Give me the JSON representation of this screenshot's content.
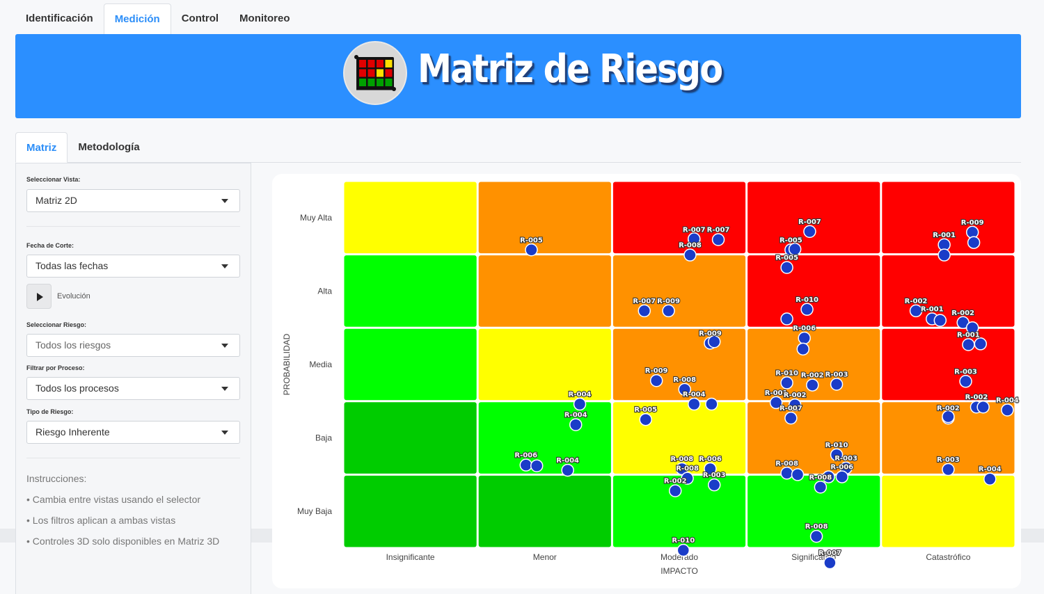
{
  "top_tabs": [
    {
      "label": "Identificación",
      "active": false
    },
    {
      "label": "Medición",
      "active": true
    },
    {
      "label": "Control",
      "active": false
    },
    {
      "label": "Monitoreo",
      "active": false
    }
  ],
  "banner": {
    "title": "Matriz de Riesgo",
    "background": "#2b8fff",
    "logo_cell_colors": [
      "#e00000",
      "#e00000",
      "#e00000",
      "#ffe000",
      "#e00000",
      "#e00000",
      "#ffe000",
      "#e00000",
      "#00a000",
      "#00a000",
      "#00a000",
      "#00a000"
    ]
  },
  "sub_tabs": [
    {
      "label": "Matriz",
      "active": true
    },
    {
      "label": "Metodología",
      "active": false
    }
  ],
  "sidebar": {
    "vista_label": "Seleccionar Vista:",
    "vista_value": "Matriz 2D",
    "fecha_label": "Fecha de Corte:",
    "fecha_value": "Todas las fechas",
    "evolucion_label": "Evolución",
    "riesgo_label": "Seleccionar Riesgo:",
    "riesgo_placeholder": "Todos los riesgos",
    "proceso_label": "Filtrar por Proceso:",
    "proceso_value": "Todos los procesos",
    "tipo_label": "Tipo de Riesgo:",
    "tipo_value": "Riesgo Inherente",
    "instrucciones_title": "Instrucciones:",
    "instrucciones": [
      "• Cambia entre vistas usando el selector",
      "• Los filtros aplican a ambas vistas",
      "• Controles 3D solo disponibles en Matriz 3D"
    ]
  },
  "chart_data": {
    "type": "scatter",
    "xlabel": "IMPACTO",
    "ylabel": "PROBABILIDAD",
    "x_categories": [
      "Insignificante",
      "Menor",
      "Moderado",
      "Significativo",
      "Catastrófico"
    ],
    "y_categories": [
      "Muy Baja",
      "Baja",
      "Media",
      "Alta",
      "Muy Alta"
    ],
    "cell_colors_top_to_bottom": [
      [
        "#ffff00",
        "#ff9100",
        "#ff0000",
        "#ff0000",
        "#ff0000"
      ],
      [
        "#00ff00",
        "#ff9100",
        "#ff9100",
        "#ff0000",
        "#ff0000"
      ],
      [
        "#00ff00",
        "#ffff00",
        "#ff9100",
        "#ff9100",
        "#ff0000"
      ],
      [
        "#00cc00",
        "#00ff00",
        "#ffff00",
        "#ff9100",
        "#ff9100"
      ],
      [
        "#00cc00",
        "#00cc00",
        "#00ff00",
        "#00ff00",
        "#ffff00"
      ]
    ],
    "marker_color": "#1a3cc8",
    "points": [
      {
        "label": "R-005",
        "x": 1.9,
        "y": 4.56
      },
      {
        "label": "R-007",
        "x": 3.11,
        "y": 4.7
      },
      {
        "label": "R-007",
        "x": 3.29,
        "y": 4.7
      },
      {
        "label": "R-008",
        "x": 3.08,
        "y": 4.49
      },
      {
        "label": "",
        "x": 3.11,
        "y": 4.71
      },
      {
        "label": "R-007",
        "x": 3.97,
        "y": 4.81
      },
      {
        "label": "R-005",
        "x": 3.83,
        "y": 4.56
      },
      {
        "label": "",
        "x": 3.86,
        "y": 4.57
      },
      {
        "label": "R-005",
        "x": 3.8,
        "y": 4.32
      },
      {
        "label": "R-001",
        "x": 4.97,
        "y": 4.63
      },
      {
        "label": "",
        "x": 4.97,
        "y": 4.49
      },
      {
        "label": "R-009",
        "x": 5.18,
        "y": 4.8
      },
      {
        "label": "",
        "x": 5.19,
        "y": 4.66
      },
      {
        "label": "R-007",
        "x": 2.74,
        "y": 3.73
      },
      {
        "label": "R-009",
        "x": 2.92,
        "y": 3.73
      },
      {
        "label": "R-009",
        "x": 3.23,
        "y": 3.29
      },
      {
        "label": "",
        "x": 3.26,
        "y": 3.31
      },
      {
        "label": "R-010",
        "x": 3.95,
        "y": 3.75
      },
      {
        "label": "",
        "x": 3.8,
        "y": 3.62
      },
      {
        "label": "R-006",
        "x": 3.93,
        "y": 3.36
      },
      {
        "label": "",
        "x": 3.92,
        "y": 3.21
      },
      {
        "label": "R-002",
        "x": 4.76,
        "y": 3.73
      },
      {
        "label": "R-001",
        "x": 4.88,
        "y": 3.62
      },
      {
        "label": "",
        "x": 4.94,
        "y": 3.6
      },
      {
        "label": "R-002",
        "x": 5.11,
        "y": 3.57
      },
      {
        "label": "",
        "x": 5.18,
        "y": 3.5
      },
      {
        "label": "R-001",
        "x": 5.15,
        "y": 3.27
      },
      {
        "label": "",
        "x": 5.24,
        "y": 3.28
      },
      {
        "label": "R-004",
        "x": 2.26,
        "y": 2.46
      },
      {
        "label": "R-004",
        "x": 2.23,
        "y": 2.18
      },
      {
        "label": "R-009",
        "x": 2.83,
        "y": 2.78
      },
      {
        "label": "R-008",
        "x": 3.04,
        "y": 2.66
      },
      {
        "label": "R-004",
        "x": 3.11,
        "y": 2.46
      },
      {
        "label": "",
        "x": 3.24,
        "y": 2.46
      },
      {
        "label": "R-005",
        "x": 2.75,
        "y": 2.25
      },
      {
        "label": "R-010",
        "x": 3.8,
        "y": 2.75
      },
      {
        "label": "R-002",
        "x": 3.99,
        "y": 2.72
      },
      {
        "label": "R-003",
        "x": 4.17,
        "y": 2.73
      },
      {
        "label": "R-001",
        "x": 3.72,
        "y": 2.48
      },
      {
        "label": "R-002",
        "x": 3.86,
        "y": 2.45
      },
      {
        "label": "R-007",
        "x": 3.83,
        "y": 2.27
      },
      {
        "label": "R-003",
        "x": 5.13,
        "y": 2.77
      },
      {
        "label": "R-002",
        "x": 5.0,
        "y": 2.27
      },
      {
        "label": "",
        "x": 5.0,
        "y": 2.29
      },
      {
        "label": "R-002",
        "x": 5.21,
        "y": 2.42
      },
      {
        "label": "",
        "x": 5.26,
        "y": 2.42
      },
      {
        "label": "R-004",
        "x": 5.44,
        "y": 2.38
      },
      {
        "label": "R-006",
        "x": 1.86,
        "y": 1.63
      },
      {
        "label": "",
        "x": 1.94,
        "y": 1.62
      },
      {
        "label": "R-004",
        "x": 2.17,
        "y": 1.56
      },
      {
        "label": "R-008",
        "x": 3.02,
        "y": 1.58
      },
      {
        "label": "R-008",
        "x": 3.06,
        "y": 1.45
      },
      {
        "label": "R-006",
        "x": 3.23,
        "y": 1.58
      },
      {
        "label": "R-003",
        "x": 3.26,
        "y": 1.36
      },
      {
        "label": "R-002",
        "x": 2.97,
        "y": 1.28
      },
      {
        "label": "R-010",
        "x": 4.17,
        "y": 1.77
      },
      {
        "label": "R-003",
        "x": 4.24,
        "y": 1.59
      },
      {
        "label": "R-008",
        "x": 3.8,
        "y": 1.52
      },
      {
        "label": "",
        "x": 3.88,
        "y": 1.5
      },
      {
        "label": "R-006",
        "x": 4.21,
        "y": 1.47
      },
      {
        "label": "R-008",
        "x": 4.05,
        "y": 1.33
      },
      {
        "label": "",
        "x": 4.11,
        "y": 1.47
      },
      {
        "label": "R-003",
        "x": 5.0,
        "y": 1.57
      },
      {
        "label": "R-004",
        "x": 5.31,
        "y": 1.44
      },
      {
        "label": "R-010",
        "x": 3.03,
        "y": 0.47
      },
      {
        "label": "R-008",
        "x": 4.02,
        "y": 0.66
      },
      {
        "label": "R-007",
        "x": 4.12,
        "y": 0.3
      }
    ]
  }
}
